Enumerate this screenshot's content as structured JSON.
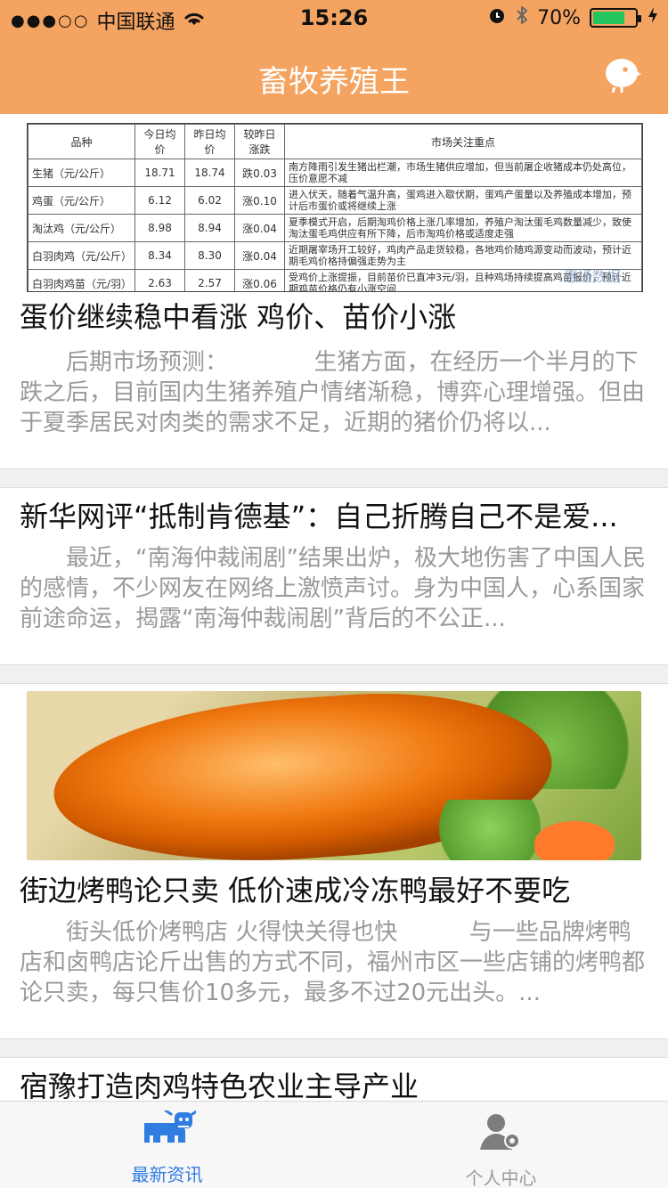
{
  "status_bar": {
    "signal_dots": "●●●○○",
    "carrier": "中国联通",
    "time": "15:26",
    "battery_percent": "70%",
    "battery_level": 0.7,
    "icons": [
      "wifi-icon",
      "alarm-icon",
      "bluetooth-icon",
      "charging-icon"
    ]
  },
  "header": {
    "title": "畜牧养殖王",
    "right_icon": "chick-icon",
    "accent": "#F4A360"
  },
  "feed": {
    "items": [
      {
        "title": "蛋价继续稳中看涨 鸡价、苗价小涨",
        "summary_lead": "后期市场预测：",
        "summary": "生猪方面，在经历一个半月的下跌之后，目前国内生猪养殖户情绪渐稳，博弈心理增强。但由于夏季居民对肉类的需求不足，近期的猪价仍将以..."
      },
      {
        "title": "新华网评“抵制肯德基”：自己折腾自己不是爱...",
        "summary": "最近，“南海仲裁闹剧”结果出炉，极大地伤害了中国人民的感情，不少网友在网络上激愤声讨。身为中国人，心系国家前途命运，揭露“南海仲裁闹剧”背后的不公正..."
      },
      {
        "title": "街边烤鸭论只卖 低价速成冷冻鸭最好不要吃",
        "summary_lead": "街头低价烤鸭店 火得快关得也快",
        "summary": "与一些品牌烤鸭店和卤鸭店论斤出售的方式不同，福州市区一些店铺的烤鸭都论只卖，每只售价10多元，最多不过20元出头。..."
      },
      {
        "title": "宿豫打造肉鸡特色农业主导产业"
      }
    ],
    "table_image": {
      "headers": [
        "品种",
        "今日均价",
        "昨日均价",
        "较昨日涨跌",
        "市场关注重点"
      ],
      "rows": [
        [
          "生猪（元/公斤）",
          "18.71",
          "18.74",
          "跌0.03",
          "南方降雨引发生猪出栏潮，市场生猪供应增加，但当前屠企收猪成本仍处高位，压价意愿不减"
        ],
        [
          "鸡蛋（元/公斤）",
          "6.12",
          "6.02",
          "涨0.10",
          "进入伏天，随着气温升高，蛋鸡进入歇伏期，蛋鸡产蛋量以及养殖成本增加，预计后市蛋价或将继续上涨"
        ],
        [
          "淘汰鸡（元/公斤）",
          "8.98",
          "8.94",
          "涨0.04",
          "夏季模式开启，后期淘鸡价格上涨几率增加，养殖户淘汰蛋毛鸡数量减少，致使淘汰蛋毛鸡供应有所下降，后市淘鸡价格或适度走强"
        ],
        [
          "白羽肉鸡（元/公斤）",
          "8.34",
          "8.30",
          "涨0.04",
          "近期屠宰场开工较好，鸡肉产品走货较稳，各地鸡价随鸡源变动而波动，预计近期毛鸡价格持偏强走势为主"
        ],
        [
          "白羽肉鸡苗（元/羽）",
          "2.63",
          "2.57",
          "涨0.06",
          "受鸡价上涨提振，目前苗价已直冲3元/羽，且种鸡场持续提高鸡苗报价，预计近期鸡苗价格仍有小涨空间"
        ]
      ],
      "watermark": "惠通数据"
    }
  },
  "tabbar": {
    "tabs": [
      {
        "label": "最新资讯",
        "icon": "cow-icon",
        "active": true
      },
      {
        "label": "个人中心",
        "icon": "user-settings-icon",
        "active": false
      }
    ],
    "active_color": "#2f7de1"
  }
}
